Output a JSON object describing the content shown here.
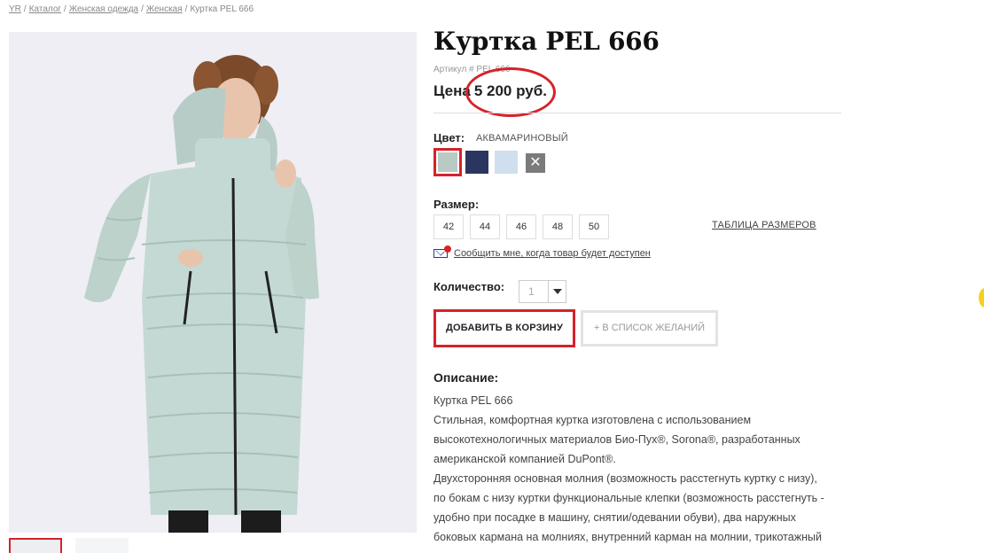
{
  "breadcrumb": {
    "items": [
      "YR",
      "Каталог",
      "Женская одежда",
      "Женская"
    ],
    "current": "Куртка PEL 666",
    "separator": "/"
  },
  "product": {
    "title": "Куртка PEL 666",
    "article": "Артикул # PEL 666",
    "price_label": "Цена",
    "price_value": "5 200 руб.",
    "color_label": "Цвет:",
    "color_value": "АКВАМАРИНОВЫЙ",
    "swatches": [
      {
        "name": "aquamarine",
        "color": "#b9c9c3",
        "selected": true
      },
      {
        "name": "navy",
        "color": "#2b3660",
        "selected": false
      },
      {
        "name": "light-blue",
        "color": "#cfdfed",
        "selected": false
      },
      {
        "name": "unavailable",
        "color": "#7b7b7b",
        "selected": false,
        "icon": "close-icon",
        "glyph": "✕"
      }
    ],
    "size_label": "Размер:",
    "sizes": [
      "42",
      "44",
      "46",
      "48",
      "50"
    ],
    "size_chart_link": "ТАБЛИЦА РАЗМЕРОВ",
    "notify_text": "Сообщить мне, когда товар будет доступен",
    "quantity_label": "Количество:",
    "quantity_value": "1",
    "add_to_cart": "ДОБАВИТЬ В КОРЗИНУ",
    "wishlist": "+ В СПИСОК ЖЕЛАНИЙ"
  },
  "description": {
    "title": "Описание:",
    "lines": [
      "Куртка PEL 666",
      "Стильная, комфортная куртка изготовлена с использованием",
      "высокотехнологичных материалов Био-Пух®, Sorona®, разработанных",
      "американской компанией DuPont®.",
      "Двухсторонняя основная молния (возможность расстегнуть куртку с низу),",
      "по бокам с низу куртки функциональные клепки (возможность расстегнуть -",
      "удобно при посадке в машину, снятии/одевании обуви),  два наружных",
      "боковых кармана на молниях, внутренний карман на молнии, трикотажный"
    ]
  },
  "colors": {
    "accent_red": "#d6222a",
    "jacket": "#c4d9d3"
  }
}
